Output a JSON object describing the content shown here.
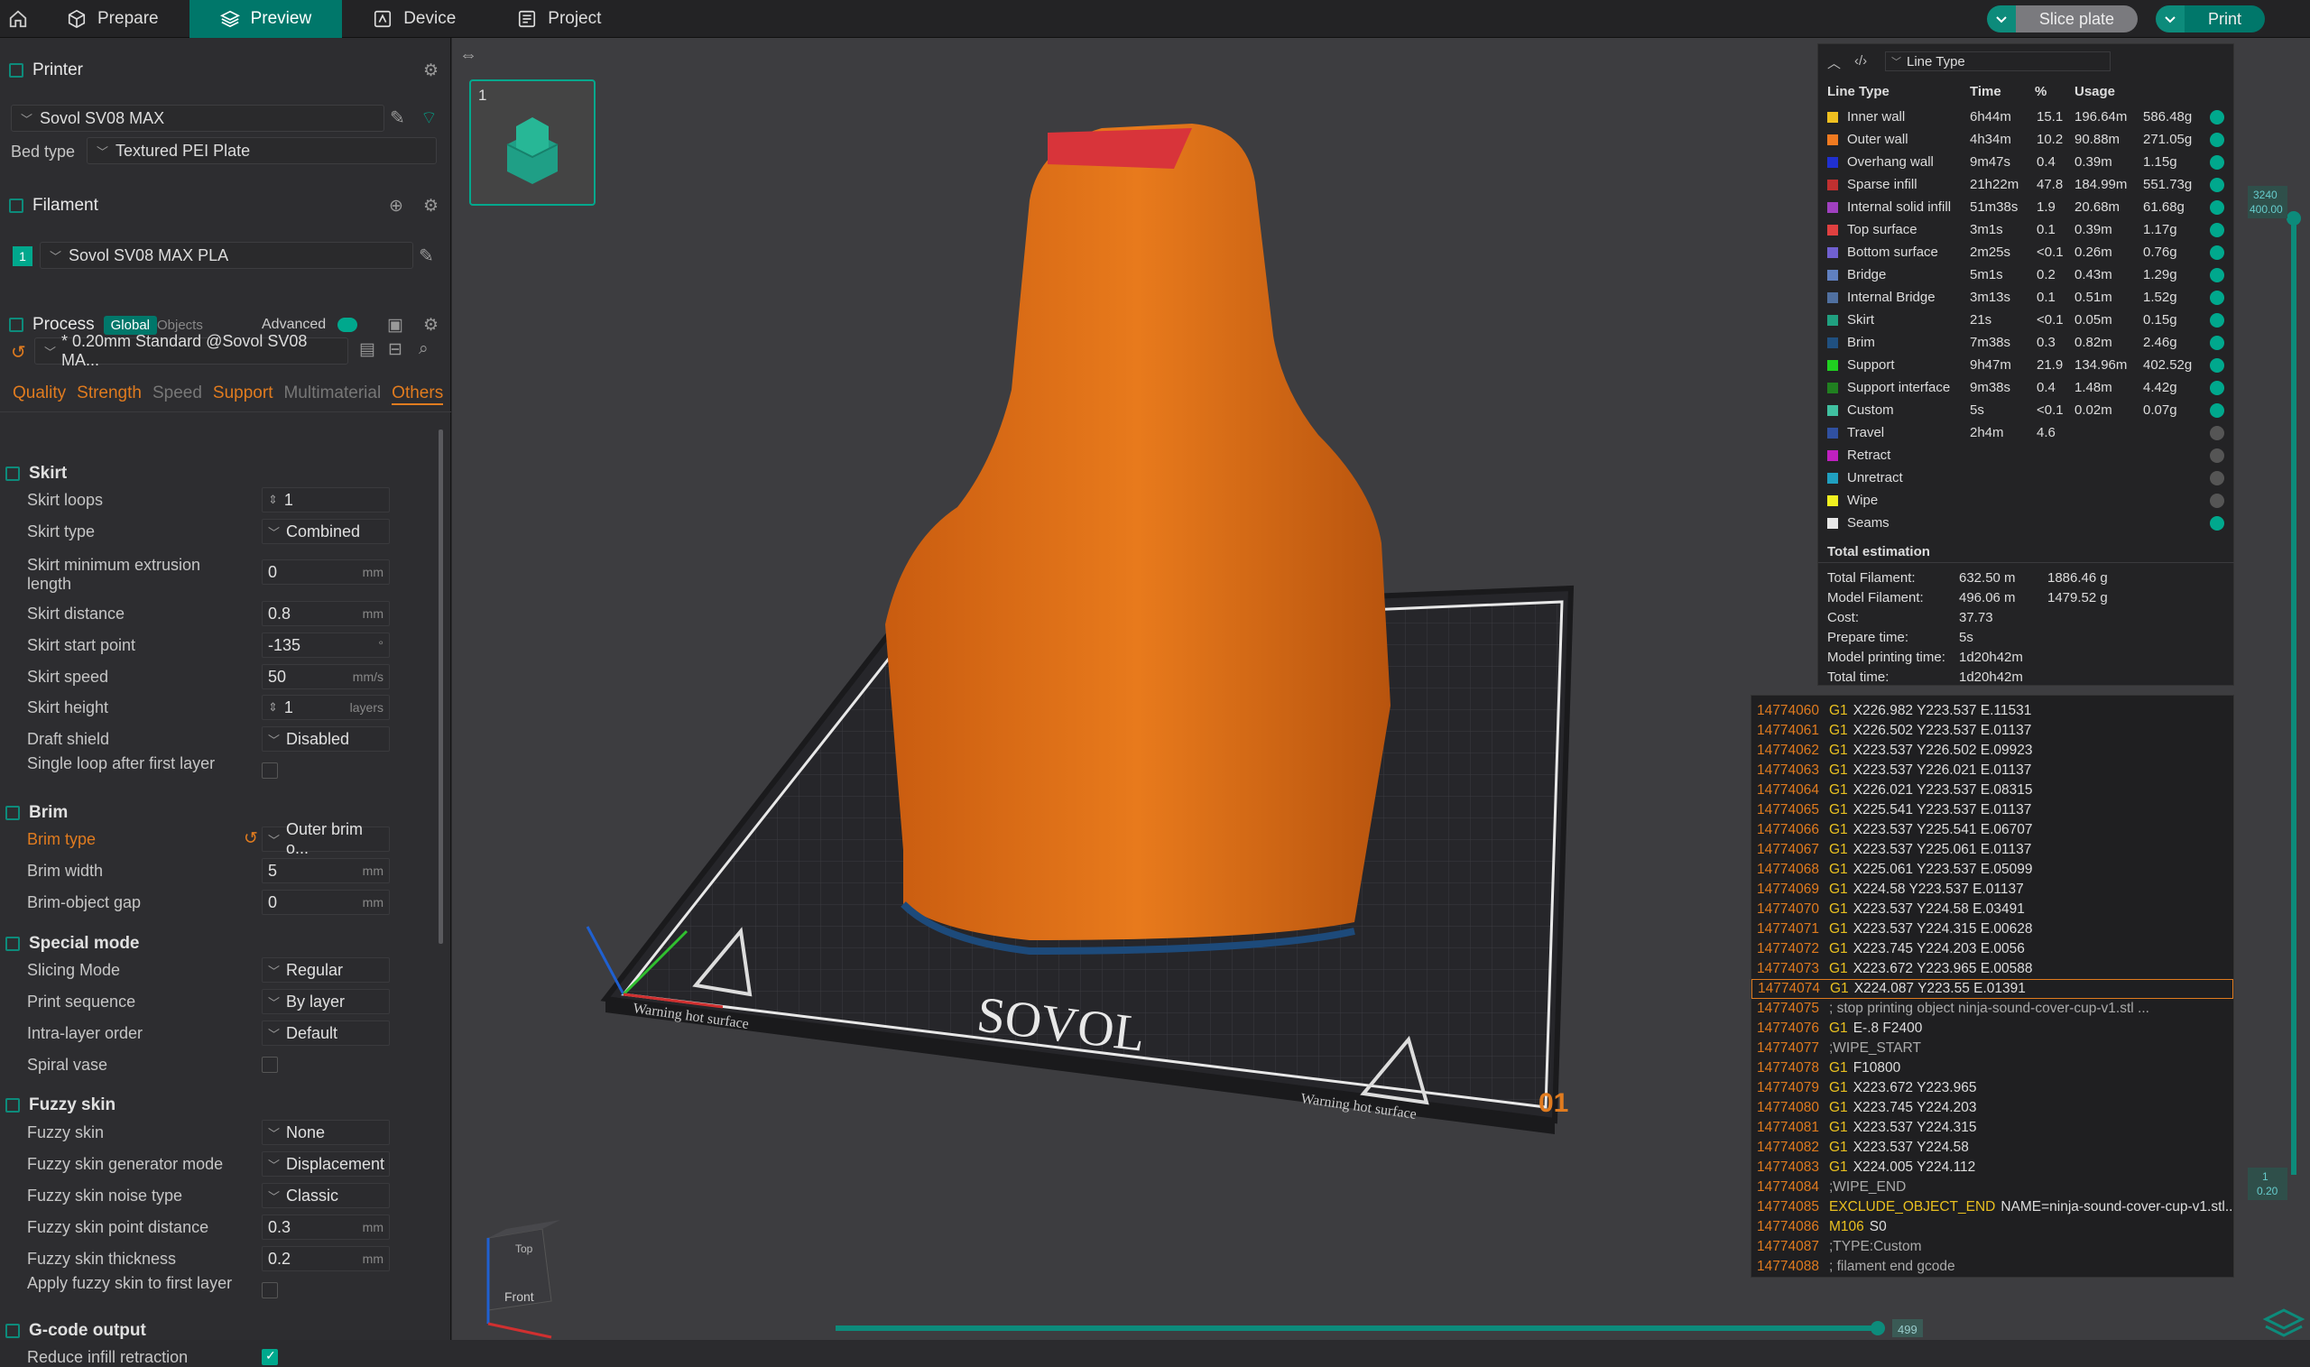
{
  "topbar": {
    "tabs": [
      "Prepare",
      "Preview",
      "Device",
      "Project"
    ],
    "slice": "Slice plate",
    "print": "Print"
  },
  "printer": {
    "header": "Printer",
    "name": "Sovol SV08 MAX",
    "bed_label": "Bed type",
    "bed_value": "Textured PEI Plate"
  },
  "filament": {
    "header": "Filament",
    "slot": "1",
    "name": "Sovol SV08 MAX PLA"
  },
  "process": {
    "header": "Process",
    "global": "Global",
    "objects": "Objects",
    "advanced": "Advanced",
    "preset": "* 0.20mm Standard @Sovol SV08 MA...",
    "tabs": [
      "Quality",
      "Strength",
      "Speed",
      "Support",
      "Multimaterial",
      "Others"
    ]
  },
  "groups": {
    "skirt": "Skirt",
    "brim": "Brim",
    "special": "Special mode",
    "fuzzy": "Fuzzy skin",
    "gcode": "G-code output"
  },
  "params": [
    {
      "label": "Skirt loops",
      "value": "1",
      "unit": "",
      "kind": "spin"
    },
    {
      "label": "Skirt type",
      "value": "Combined",
      "unit": "",
      "kind": "select"
    },
    {
      "label": "Skirt minimum extrusion length",
      "value": "0",
      "unit": "mm",
      "kind": "text"
    },
    {
      "label": "Skirt distance",
      "value": "0.8",
      "unit": "mm",
      "kind": "text"
    },
    {
      "label": "Skirt start point",
      "value": "-135",
      "unit": "°",
      "kind": "text"
    },
    {
      "label": "Skirt speed",
      "value": "50",
      "unit": "mm/s",
      "kind": "text"
    },
    {
      "label": "Skirt height",
      "value": "1",
      "unit": "layers",
      "kind": "spin"
    },
    {
      "label": "Draft shield",
      "value": "Disabled",
      "unit": "",
      "kind": "select"
    },
    {
      "label": "Single loop after first layer",
      "value": "",
      "unit": "",
      "kind": "check"
    },
    {
      "label": "Brim type",
      "value": "Outer brim o...",
      "unit": "",
      "kind": "select"
    },
    {
      "label": "Brim width",
      "value": "5",
      "unit": "mm",
      "kind": "text"
    },
    {
      "label": "Brim-object gap",
      "value": "0",
      "unit": "mm",
      "kind": "text"
    },
    {
      "label": "Slicing Mode",
      "value": "Regular",
      "unit": "",
      "kind": "select"
    },
    {
      "label": "Print sequence",
      "value": "By layer",
      "unit": "",
      "kind": "select"
    },
    {
      "label": "Intra-layer order",
      "value": "Default",
      "unit": "",
      "kind": "select"
    },
    {
      "label": "Spiral vase",
      "value": "",
      "unit": "",
      "kind": "check"
    },
    {
      "label": "Fuzzy skin",
      "value": "None",
      "unit": "",
      "kind": "select"
    },
    {
      "label": "Fuzzy skin generator mode",
      "value": "Displacement",
      "unit": "",
      "kind": "select"
    },
    {
      "label": "Fuzzy skin noise type",
      "value": "Classic",
      "unit": "",
      "kind": "select"
    },
    {
      "label": "Fuzzy skin point distance",
      "value": "0.3",
      "unit": "mm",
      "kind": "text"
    },
    {
      "label": "Fuzzy skin thickness",
      "value": "0.2",
      "unit": "mm",
      "kind": "text"
    },
    {
      "label": "Apply fuzzy skin to first layer",
      "value": "",
      "unit": "",
      "kind": "check"
    },
    {
      "label": "Reduce infill retraction",
      "value": "",
      "unit": "",
      "kind": "checkon"
    }
  ],
  "plate": {
    "number": "1",
    "brand": "SOVOL",
    "warning": "Warning hot surface",
    "plate_no": "01"
  },
  "viewcube": {
    "top": "Top",
    "front": "Front"
  },
  "slider": {
    "top_a": "3240",
    "top_b": "400.00",
    "bottom_a": "1",
    "bottom_b": "0.20",
    "h_value": "499"
  },
  "linetype": {
    "dropdown": "Line Type",
    "cols": [
      "Line Type",
      "Time",
      "%",
      "Usage"
    ],
    "rows": [
      {
        "name": "Inner wall",
        "time": "6h44m",
        "pct": "15.1",
        "len": "196.64m",
        "wt": "586.48g",
        "color": "#f0c020",
        "vis": true
      },
      {
        "name": "Outer wall",
        "time": "4h34m",
        "pct": "10.2",
        "len": "90.88m",
        "wt": "271.05g",
        "color": "#f07a20",
        "vis": true
      },
      {
        "name": "Overhang wall",
        "time": "9m47s",
        "pct": "0.4",
        "len": "0.39m",
        "wt": "1.15g",
        "color": "#2030d0",
        "vis": true
      },
      {
        "name": "Sparse infill",
        "time": "21h22m",
        "pct": "47.8",
        "len": "184.99m",
        "wt": "551.73g",
        "color": "#c03030",
        "vis": true
      },
      {
        "name": "Internal solid infill",
        "time": "51m38s",
        "pct": "1.9",
        "len": "20.68m",
        "wt": "61.68g",
        "color": "#a040c0",
        "vis": true
      },
      {
        "name": "Top surface",
        "time": "3m1s",
        "pct": "0.1",
        "len": "0.39m",
        "wt": "1.17g",
        "color": "#e04040",
        "vis": true
      },
      {
        "name": "Bottom surface",
        "time": "2m25s",
        "pct": "<0.1",
        "len": "0.26m",
        "wt": "0.76g",
        "color": "#7060d0",
        "vis": true
      },
      {
        "name": "Bridge",
        "time": "5m1s",
        "pct": "0.2",
        "len": "0.43m",
        "wt": "1.29g",
        "color": "#6080c0",
        "vis": true
      },
      {
        "name": "Internal Bridge",
        "time": "3m13s",
        "pct": "0.1",
        "len": "0.51m",
        "wt": "1.52g",
        "color": "#5070a0",
        "vis": true
      },
      {
        "name": "Skirt",
        "time": "21s",
        "pct": "<0.1",
        "len": "0.05m",
        "wt": "0.15g",
        "color": "#20a080",
        "vis": true
      },
      {
        "name": "Brim",
        "time": "7m38s",
        "pct": "0.3",
        "len": "0.82m",
        "wt": "2.46g",
        "color": "#205080",
        "vis": true
      },
      {
        "name": "Support",
        "time": "9h47m",
        "pct": "21.9",
        "len": "134.96m",
        "wt": "402.52g",
        "color": "#20d020",
        "vis": true
      },
      {
        "name": "Support interface",
        "time": "9m38s",
        "pct": "0.4",
        "len": "1.48m",
        "wt": "4.42g",
        "color": "#208020",
        "vis": true
      },
      {
        "name": "Custom",
        "time": "5s",
        "pct": "<0.1",
        "len": "0.02m",
        "wt": "0.07g",
        "color": "#40c0a0",
        "vis": true
      },
      {
        "name": "Travel",
        "time": "2h4m",
        "pct": "4.6",
        "len": "",
        "wt": "",
        "color": "#3050a0",
        "vis": false
      },
      {
        "name": "Retract",
        "time": "",
        "pct": "",
        "len": "",
        "wt": "",
        "color": "#c020c0",
        "vis": false
      },
      {
        "name": "Unretract",
        "time": "",
        "pct": "",
        "len": "",
        "wt": "",
        "color": "#20a0c0",
        "vis": false
      },
      {
        "name": "Wipe",
        "time": "",
        "pct": "",
        "len": "",
        "wt": "",
        "color": "#f0f020",
        "vis": false
      },
      {
        "name": "Seams",
        "time": "",
        "pct": "",
        "len": "",
        "wt": "",
        "color": "#e8e8e8",
        "vis": true
      }
    ],
    "total_title": "Total estimation",
    "totals": [
      {
        "label": "Total Filament:",
        "a": "632.50 m",
        "b": "1886.46 g"
      },
      {
        "label": "Model Filament:",
        "a": "496.06 m",
        "b": "1479.52 g"
      },
      {
        "label": "Cost:",
        "a": "37.73",
        "b": ""
      },
      {
        "label": "Prepare time:",
        "a": "5s",
        "b": ""
      },
      {
        "label": "Model printing time:",
        "a": "1d20h42m",
        "b": ""
      },
      {
        "label": "Total time:",
        "a": "1d20h42m",
        "b": ""
      }
    ]
  },
  "gcode": [
    {
      "n": "14774060",
      "c": "G1",
      "t": "X226.982 Y223.537 E.11531"
    },
    {
      "n": "14774061",
      "c": "G1",
      "t": "X226.502 Y223.537 E.01137"
    },
    {
      "n": "14774062",
      "c": "G1",
      "t": "X223.537 Y226.502 E.09923"
    },
    {
      "n": "14774063",
      "c": "G1",
      "t": "X223.537 Y226.021 E.01137"
    },
    {
      "n": "14774064",
      "c": "G1",
      "t": "X226.021 Y223.537 E.08315"
    },
    {
      "n": "14774065",
      "c": "G1",
      "t": "X225.541 Y223.537 E.01137"
    },
    {
      "n": "14774066",
      "c": "G1",
      "t": "X223.537 Y225.541 E.06707"
    },
    {
      "n": "14774067",
      "c": "G1",
      "t": "X223.537 Y225.061 E.01137"
    },
    {
      "n": "14774068",
      "c": "G1",
      "t": "X225.061 Y223.537 E.05099"
    },
    {
      "n": "14774069",
      "c": "G1",
      "t": "X224.58 Y223.537 E.01137"
    },
    {
      "n": "14774070",
      "c": "G1",
      "t": "X223.537 Y224.58 E.03491"
    },
    {
      "n": "14774071",
      "c": "G1",
      "t": "X223.537 Y224.315 E.00628"
    },
    {
      "n": "14774072",
      "c": "G1",
      "t": "X223.745 Y224.203 E.0056"
    },
    {
      "n": "14774073",
      "c": "G1",
      "t": "X223.672 Y223.965 E.00588"
    },
    {
      "n": "14774074",
      "c": "G1",
      "t": "X224.087 Y223.55 E.01391"
    },
    {
      "n": "14774075",
      "c": "",
      "t": "; stop printing object ninja-sound-cover-cup-v1.stl ..."
    },
    {
      "n": "14774076",
      "c": "G1",
      "t": "E-.8 F2400"
    },
    {
      "n": "14774077",
      "c": "",
      "t": ";WIPE_START"
    },
    {
      "n": "14774078",
      "c": "G1",
      "t": "F10800"
    },
    {
      "n": "14774079",
      "c": "G1",
      "t": "X223.672 Y223.965"
    },
    {
      "n": "14774080",
      "c": "G1",
      "t": "X223.745 Y224.203"
    },
    {
      "n": "14774081",
      "c": "G1",
      "t": "X223.537 Y224.315"
    },
    {
      "n": "14774082",
      "c": "G1",
      "t": "X223.537 Y224.58"
    },
    {
      "n": "14774083",
      "c": "G1",
      "t": "X224.005 Y224.112"
    },
    {
      "n": "14774084",
      "c": "",
      "t": ";WIPE_END"
    },
    {
      "n": "14774085",
      "c": "EXCLUDE_OBJECT_END",
      "t": "NAME=ninja-sound-cover-cup-v1.stl..."
    },
    {
      "n": "14774086",
      "c": "M106",
      "t": "S0"
    },
    {
      "n": "14774087",
      "c": "",
      "t": ";TYPE:Custom"
    },
    {
      "n": "14774088",
      "c": "",
      "t": "; filament end gcode"
    }
  ]
}
